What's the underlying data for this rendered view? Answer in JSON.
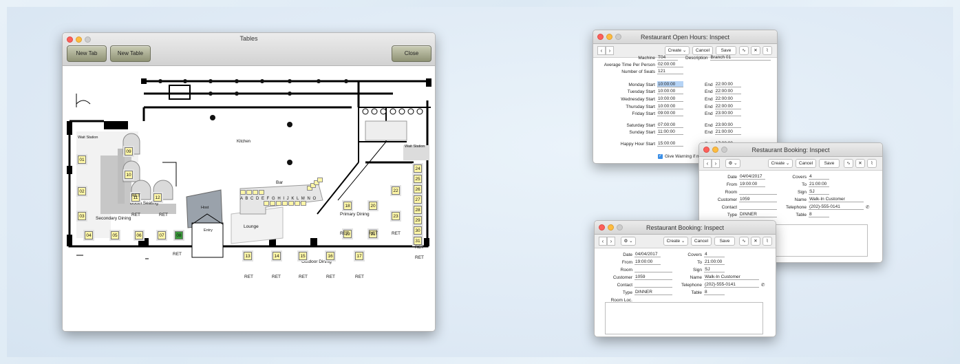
{
  "tables_window": {
    "title": "Tables",
    "buttons": {
      "new_tab": "New Tab",
      "new_table": "New Table",
      "close": "Close"
    },
    "areas": {
      "kitchen": "Kitchen",
      "wait_station_left": "Wait Station",
      "wait_station_right": "Wait Station",
      "booth_seating": "Booth Seating",
      "bar": "Bar",
      "host": "Host",
      "entry": "Entry",
      "lounge": "Lounge",
      "secondary_dining": "Secondary Dining",
      "primary_dining": "Primary Dining",
      "outdoor_dining": "Outdoor Dining"
    },
    "tables": [
      "01",
      "02",
      "03",
      "04",
      "05",
      "06",
      "07",
      "08",
      "09",
      "10",
      "11",
      "12",
      "13",
      "14",
      "15",
      "16",
      "17",
      "18",
      "19",
      "20",
      "21",
      "22",
      "23",
      "24",
      "25",
      "26",
      "27",
      "28",
      "29",
      "30",
      "31"
    ],
    "bar_seats": "A B C D E F G H I J K L M N O",
    "ret_label": "RET"
  },
  "open_hours": {
    "title": "Restaurant Open Hours: Inspect",
    "toolbar": {
      "create": "Create",
      "cancel": "Cancel",
      "save": "Save"
    },
    "machine_label": "Machine",
    "machine": "T04",
    "description_label": "Description",
    "description": "Branch 01",
    "avg_label": "Average Time Per Person",
    "avg": "02:00:00",
    "seats_label": "Number of Seats",
    "seats": "121",
    "days": [
      {
        "label": "Monday Start",
        "start": "10:00:00",
        "end": "22:00:00"
      },
      {
        "label": "Tuesday Start",
        "start": "10:00:00",
        "end": "22:00:00"
      },
      {
        "label": "Wednesday Start",
        "start": "10:00:00",
        "end": "22:00:00"
      },
      {
        "label": "Thursday Start",
        "start": "10:00:00",
        "end": "22:00:00"
      },
      {
        "label": "Friday Start",
        "start": "09:00:00",
        "end": "23:00:00"
      },
      {
        "label": "Saturday Start",
        "start": "07:00:00",
        "end": "23:00:00"
      },
      {
        "label": "Sunday Start",
        "start": "11:00:00",
        "end": "21:00:00"
      },
      {
        "label": "Happy Hour Start",
        "start": "15:00:00",
        "end": "17:00:00"
      }
    ],
    "end_label": "End",
    "warning": "Give Warning if mo"
  },
  "booking": {
    "title": "Restaurant Booking: Inspect",
    "toolbar": {
      "create": "Create",
      "cancel": "Cancel",
      "save": "Save"
    },
    "date_label": "Date",
    "date": "04/04/2017",
    "from_label": "From",
    "from": "19:00:00",
    "room_label": "Room",
    "room": "",
    "customer_label": "Customer",
    "customer": "1059",
    "contact_label": "Contact",
    "contact": "",
    "type_label": "Type",
    "type": "DINNER",
    "roomloc_label": "Room Loc.",
    "roomloc": "",
    "covers_label": "Covers",
    "covers": "4",
    "to_label": "To",
    "to": "21:00:00",
    "sign_label": "Sign",
    "sign": "SJ",
    "name_label": "Name",
    "name": "Walk-In Customer",
    "telephone_label": "Telephone",
    "telephone": "(202)-555-0141",
    "table_label": "Table",
    "table": "8"
  }
}
